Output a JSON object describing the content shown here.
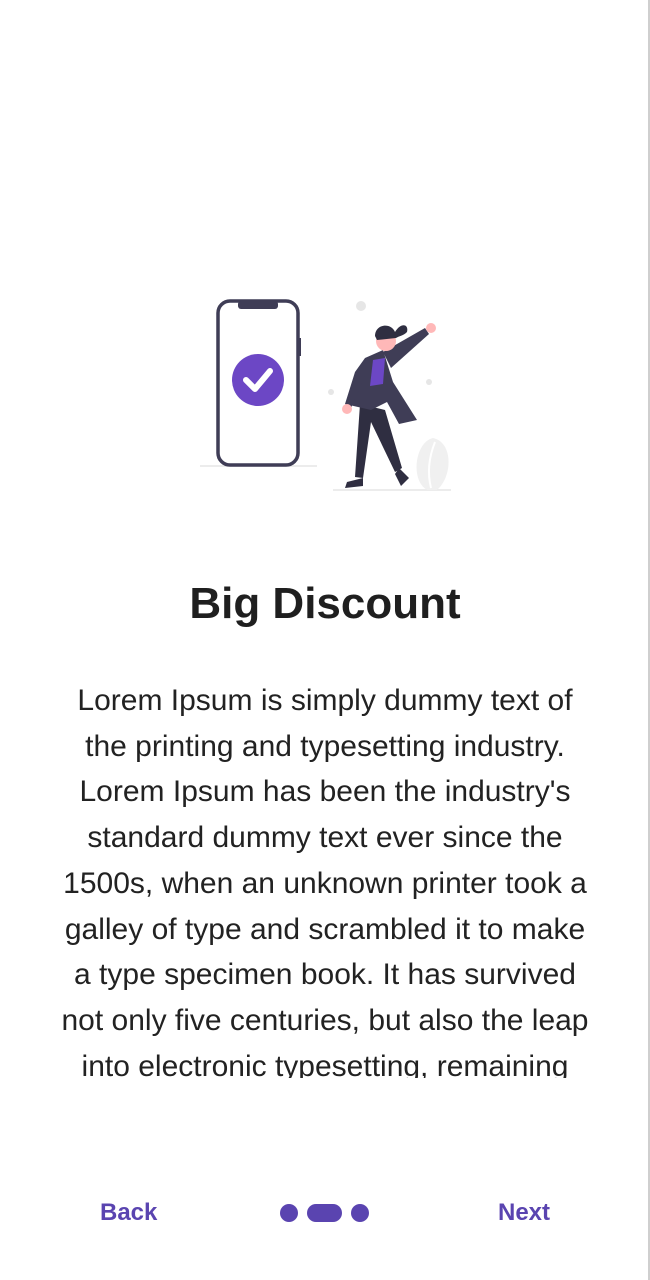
{
  "onboarding": {
    "title": "Big Discount",
    "description": "Lorem Ipsum is simply dummy text of the printing and typesetting industry. Lorem Ipsum has been the industry's standard dummy text ever since the 1500s, when an unknown printer took a galley of type and scrambled it to make a type specimen book. It has survived not only five centuries, but also the leap into electronic typesetting, remaining essentially unchanged.",
    "illustration_icon": "phone-checkmark-woman-illustration"
  },
  "footer": {
    "back_label": "Back",
    "next_label": "Next",
    "page_indicator": {
      "total": 3,
      "active_index": 1
    }
  },
  "colors": {
    "accent": "#5a44b0",
    "text_dark": "#1f1f1f",
    "background": "#ffffff"
  }
}
